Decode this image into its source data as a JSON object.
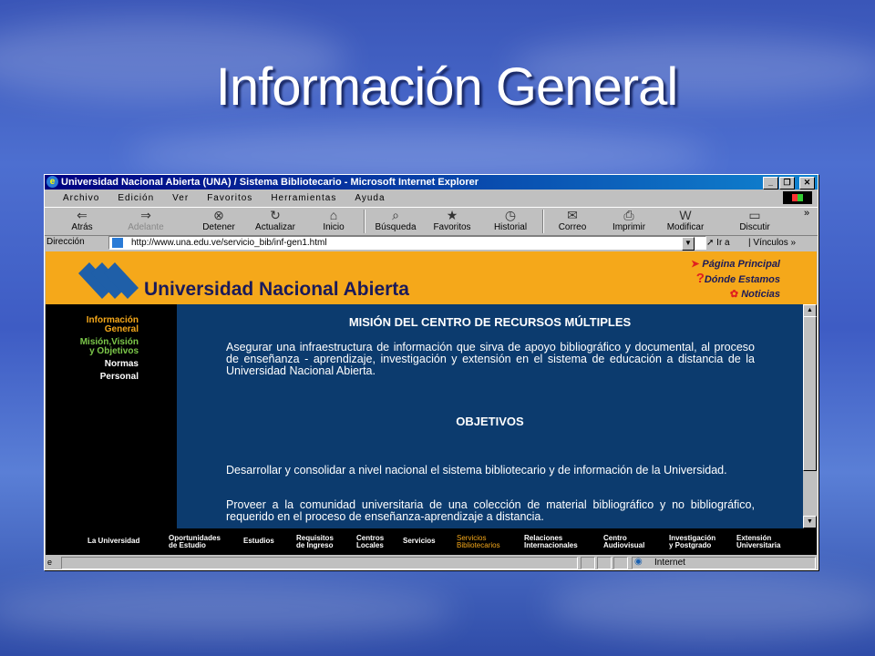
{
  "slide": {
    "title": "Información General"
  },
  "window": {
    "title": "Universidad Nacional Abierta (UNA) / Sistema Bibliotecario - Microsoft Internet Explorer",
    "controls": {
      "minimize": "_",
      "maximize": "❐",
      "close": "✕"
    }
  },
  "menu": [
    "Archivo",
    "Edición",
    "Ver",
    "Favoritos",
    "Herramientas",
    "Ayuda"
  ],
  "toolbar": {
    "back": "Atrás",
    "forward": "Adelante",
    "stop": "Detener",
    "refresh": "Actualizar",
    "home": "Inicio",
    "search": "Búsqueda",
    "favorites": "Favoritos",
    "history": "Historial",
    "mail": "Correo",
    "print": "Imprimir",
    "edit": "Modificar",
    "discuss": "Discutir",
    "overflow": "»"
  },
  "address": {
    "label": "Dirección",
    "url": "http://www.una.edu.ve/servicio_bib/inf-gen1.html",
    "go": "Ir a",
    "links": "Vínculos"
  },
  "site": {
    "name": "Universidad Nacional Abierta",
    "topnav": [
      "Página Principal",
      "Dónde Estamos",
      "Noticias"
    ],
    "topnav_marks": [
      "?"
    ],
    "sidebar": [
      {
        "label": "Información",
        "color": "#f5a81a"
      },
      {
        "label": "General",
        "color": "#f5a81a"
      },
      {
        "label": "Misión,Visión",
        "color": "#7cc84a"
      },
      {
        "label": "y Objetivos",
        "color": "#7cc84a"
      },
      {
        "label": "Normas",
        "color": "#ffffff"
      },
      {
        "label": "Personal",
        "color": "#ffffff"
      }
    ],
    "heading1": "MISIÓN DEL CENTRO DE RECURSOS MÚLTIPLES",
    "para1": "Asegurar una infraestructura de información que sirva de apoyo bibliográfico y documental, al proceso de enseñanza - aprendizaje, investigación y extensión en el sistema de educación a distancia de la Universidad Nacional Abierta.",
    "heading2": "OBJETIVOS",
    "para2": "Desarrollar y consolidar a nivel nacional el sistema bibliotecario y de información de la Universidad.",
    "para3": "Proveer a la comunidad universitaria de una colección de material bibliográfico y no bibliográfico, requerido en el proceso de enseñanza-aprendizaje a distancia.",
    "footer": [
      {
        "l1": "La Universidad",
        "l2": ""
      },
      {
        "l1": "Oportunidades",
        "l2": "de Estudio"
      },
      {
        "l1": "Estudios",
        "l2": ""
      },
      {
        "l1": "Requisitos",
        "l2": "de Ingreso"
      },
      {
        "l1": "Centros",
        "l2": "Locales"
      },
      {
        "l1": "Servicios",
        "l2": ""
      },
      {
        "l1": "Servicios",
        "l2": "Bibliotecarios"
      },
      {
        "l1": "Relaciones",
        "l2": "Internacionales"
      },
      {
        "l1": "Centro",
        "l2": "Audiovisual"
      },
      {
        "l1": "Investigación",
        "l2": "y Postgrado"
      },
      {
        "l1": "Extensión",
        "l2": "Universitaria"
      }
    ]
  },
  "status": {
    "zone": "Internet"
  },
  "colors": {
    "banner": "#f5a81a",
    "content_bg": "#0c3b6e",
    "logo_blue": "#1f5fa8"
  }
}
